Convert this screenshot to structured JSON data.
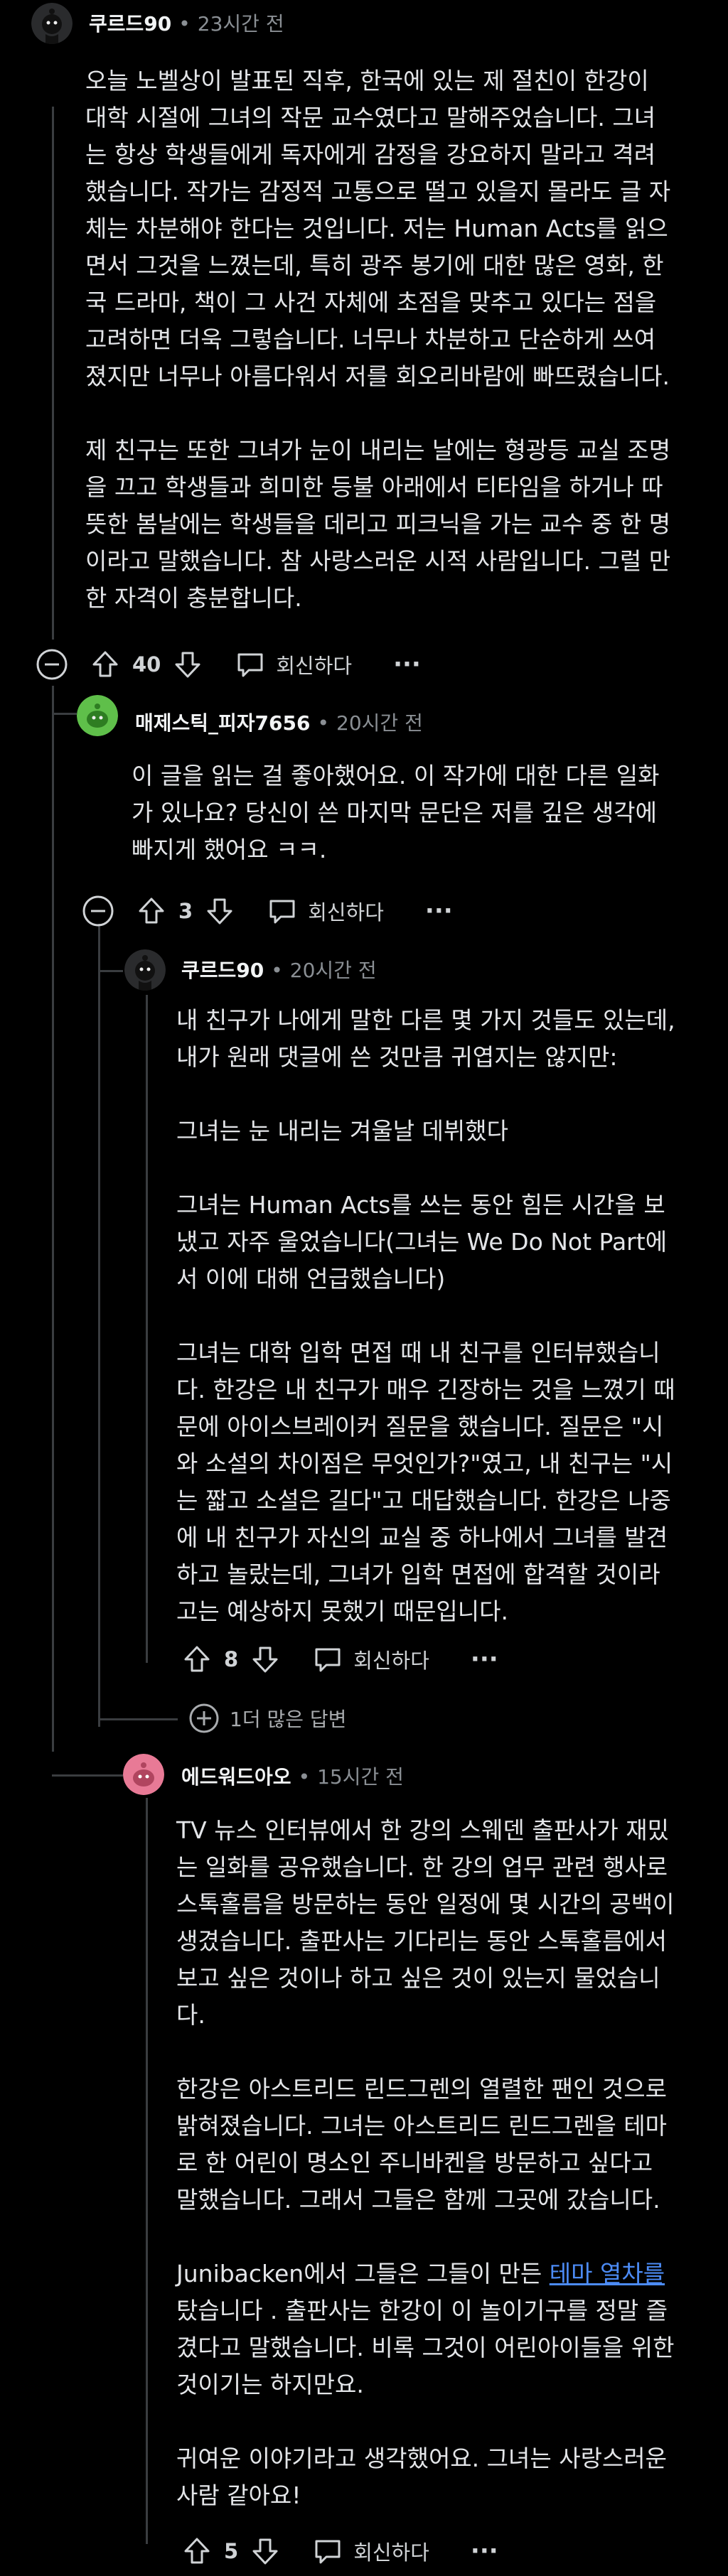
{
  "comments": {
    "c1": {
      "author": "쿠르드90",
      "dot": "•",
      "time": "23시간 전",
      "paragraphs": [
        "오늘 노벨상이 발표된 직후, 한국에 있는 제 절친이 한강이\n대학 시절에 그녀의 작문 교수였다고 말해주었습니다. 그녀\n는 항상 학생들에게 독자에게 감정을 강요하지 말라고 격려\n했습니다. 작가는 감정적 고통으로 떨고 있을지 몰라도 글 자\n체는 차분해야 한다는 것입니다. 저는 Human Acts를 읽으\n면서 그것을 느꼈는데, 특히 광주 봉기에 대한 많은 영화, 한\n국 드라마, 책이 그 사건 자체에 초점을 맞추고 있다는 점을\n고려하면 더욱 그렇습니다. 너무나 차분하고 단순하게 쓰여\n졌지만 너무나 아름다워서 저를 회오리바람에 빠뜨렸습니다.",
        "제 친구는 또한 그녀가 눈이 내리는 날에는 형광등 교실 조명\n을 끄고 학생들과 희미한 등불 아래에서 티타임을 하거나 따\n뜻한 봄날에는 학생들을 데리고 피크닉을 가는 교수 중 한 명\n이라고 말했습니다. 참 사랑스러운 시적 사람입니다. 그럴 만\n한 자격이 충분합니다."
      ],
      "votes": "40",
      "reply_label": "회신하다",
      "more": "···"
    },
    "c2": {
      "author": "매제스틱_피자7656",
      "dot": "•",
      "time": "20시간 전",
      "paragraphs": [
        "이 글을 읽는 걸 좋아했어요. 이 작가에 대한 다른 일화\n가 있나요? 당신이 쓴 마지막 문단은 저를 깊은 생각에\n빠지게 했어요 ㅋㅋ."
      ],
      "votes": "3",
      "reply_label": "회신하다",
      "more": "···"
    },
    "c3": {
      "author": "쿠르드90",
      "dot": "•",
      "time": "20시간 전",
      "paragraphs": [
        "내 친구가 나에게 말한 다른 몇 가지 것들도 있는데,\n내가 원래 댓글에 쓴 것만큼 귀엽지는 않지만:",
        "그녀는 눈 내리는 겨울날 데뷔했다",
        "그녀는 Human Acts를 쓰는 동안 힘든 시간을 보\n냈고 자주 울었습니다(그녀는 We Do Not Part에\n서 이에 대해 언급했습니다)",
        "그녀는 대학 입학 면접 때 내 친구를 인터뷰했습니\n다. 한강은 내 친구가 매우 긴장하는 것을 느꼈기 때\n문에 아이스브레이커 질문을 했습니다. 질문은 \"시\n와 소설의 차이점은 무엇인가?\"였고, 내 친구는 \"시\n는 짧고 소설은 길다\"고 대답했습니다. 한강은 나중\n에 내 친구가 자신의 교실 중 하나에서 그녀를 발견\n하고 놀랐는데, 그녀가 입학 면접에 합격할 것이라\n고는 예상하지 못했기 때문입니다."
      ],
      "votes": "8",
      "reply_label": "회신하다",
      "more": "···"
    },
    "more_replies": "1더 많은 답변",
    "c4": {
      "author": "에드워드아오",
      "dot": "•",
      "time": "15시간 전",
      "p1": "TV 뉴스 인터뷰에서 한 강의 스웨덴 출판사가 재밌\n는 일화를 공유했습니다. 한 강의 업무 관련 행사로\n스톡홀름을 방문하는 동안 일정에 몇 시간의 공백이\n생겼습니다. 출판사는 기다리는 동안 스톡홀름에서\n보고 싶은 것이나 하고 싶은 것이 있는지 물었습니\n다.",
      "p2": "한강은 아스트리드 린드그렌의 열렬한 팬인 것으로\n밝혀졌습니다. 그녀는 아스트리드 린드그렌을 테마\n로 한 어린이 명소인 주니바켄을 방문하고 싶다고\n말했습니다. 그래서 그들은 함께 그곳에 갔습니다.",
      "p3_before": "Junibacken에서 그들은 그들이 만든 ",
      "p3_link": "테마 열차를",
      "p3_after": "\n탔습니다 . 출판사는 한강이 이 놀이기구를 정말 즐\n겼다고 말했습니다. 비록 그것이 어린아이들을 위한\n것이기는 하지만요.",
      "p4": "귀여운 이야기라고 생각했어요. 그녀는 사랑스러운\n사람 같아요!",
      "votes": "5",
      "reply_label": "회신하다",
      "more": "···"
    }
  },
  "colors": {
    "bg": "#000000",
    "text": "#e3e5e8",
    "muted": "#8a8f94",
    "thread_line": "#3a3d40",
    "link": "#4c8bf5",
    "avatar_green": "#5fbf4a",
    "avatar_pink": "#e87a96"
  }
}
